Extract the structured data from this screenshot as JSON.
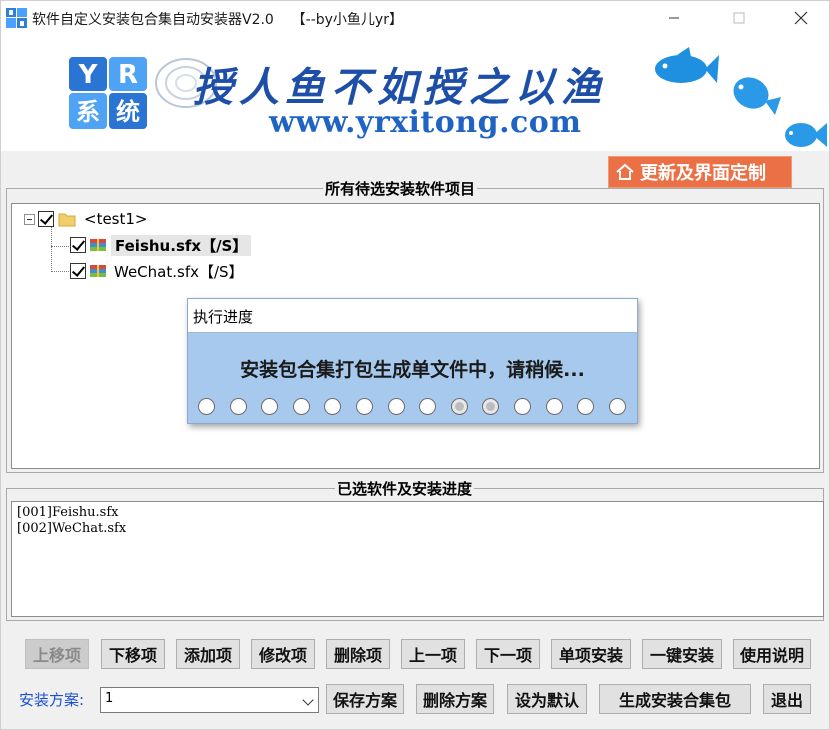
{
  "window": {
    "title": "软件自定义安装包合集自动安装器V2.0",
    "author_tag": "【--by小鱼儿yr】"
  },
  "banner": {
    "slogan": "授人鱼不如授之以渔",
    "url": "www.yrxitong.com",
    "logo_text": [
      "Y",
      "R",
      "系",
      "统"
    ]
  },
  "update_button": {
    "label": "更新及界面定制",
    "icon": "home-icon"
  },
  "software_group": {
    "title": "所有待选安装软件项目",
    "tree": {
      "root": "<test1>",
      "items": [
        {
          "label": "Feishu.sfx【/S】",
          "checked": true,
          "selected": true
        },
        {
          "label": "WeChat.sfx【/S】",
          "checked": true,
          "selected": false
        }
      ]
    }
  },
  "progress_dialog": {
    "title": "执行进度",
    "message": "安装包合集打包生成单文件中，请稍候...",
    "dot_count": 14,
    "active_dots": [
      8,
      9
    ]
  },
  "selected_group": {
    "title": "已选软件及安装进度",
    "lines": [
      "[001]Feishu.sfx",
      "[002]WeChat.sfx"
    ]
  },
  "buttons": {
    "move_up": "上移项",
    "move_down": "下移项",
    "add": "添加项",
    "edit": "修改项",
    "delete": "删除项",
    "prev": "上一项",
    "next": "下一项",
    "single_install": "单项安装",
    "one_click_install": "一键安装",
    "help": "使用说明",
    "save_scheme": "保存方案",
    "delete_scheme": "删除方案",
    "set_default": "设为默认",
    "build_bundle": "生成安装合集包",
    "exit": "退出"
  },
  "scheme": {
    "label": "安装方案:",
    "value": "1"
  },
  "colors": {
    "accent_orange": "#ec7046",
    "dialog_blue": "#a7c9ee",
    "banner_blue": "#1d4ea8",
    "scheme_label_blue": "#1c4fd0"
  }
}
